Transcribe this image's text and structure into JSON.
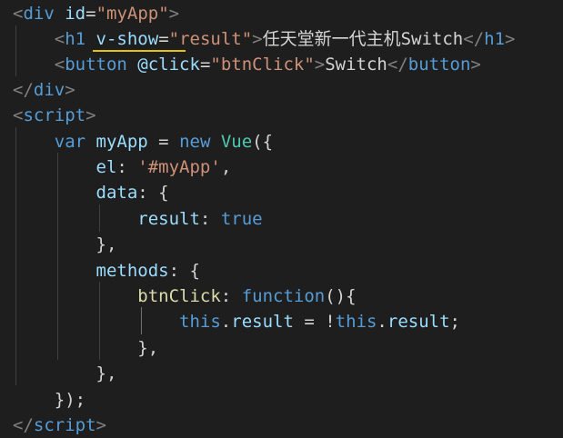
{
  "code": {
    "line1": {
      "open": "<",
      "tag": "div",
      "attr": " id",
      "eq": "=",
      "val": "\"myApp\"",
      "close": ">"
    },
    "line2": {
      "open": "<",
      "tag": "h1",
      "attr": " v-show",
      "eq": "=",
      "val": "\"result\"",
      "close": ">",
      "text": "任天堂新一代主机Switch",
      "end_open": "</",
      "end_tag": "h1",
      "end_close": ">"
    },
    "line3": {
      "open": "<",
      "tag": "button",
      "attr": " @click",
      "eq": "=",
      "val": "\"btnClick\"",
      "close": ">",
      "text": "Switch",
      "end_open": "</",
      "end_tag": "button",
      "end_close": ">"
    },
    "line4": {
      "open": "</",
      "tag": "div",
      "close": ">"
    },
    "line5": {
      "open": "<",
      "tag": "script",
      "close": ">"
    },
    "line6": {
      "kw": "var",
      "var": " myApp",
      "op": " = ",
      "kw2": "new",
      "cls": " Vue",
      "rest": "({"
    },
    "line7": {
      "prop": "el",
      "colon": ": ",
      "str": "'#myApp'",
      "rest": ","
    },
    "line8": {
      "prop": "data",
      "rest": ": {"
    },
    "line9": {
      "prop": "result",
      "colon": ": ",
      "kw": "true"
    },
    "line10": {
      "rest": "},"
    },
    "line11": {
      "prop": "methods",
      "rest": ": {"
    },
    "line12": {
      "fn": "btnClick",
      "colon": ": ",
      "kw": "function",
      "rest": "(){"
    },
    "line13": {
      "kw": "this",
      "dot": ".",
      "prop": "result",
      "op": " = !",
      "kw2": "this",
      "dot2": ".",
      "prop2": "result",
      "rest": ";"
    },
    "line14": {
      "rest": "},"
    },
    "line15": {
      "rest": "},"
    },
    "line16": {
      "rest": "});"
    },
    "line17": {
      "open": "</",
      "tag": "script",
      "close": ">"
    }
  },
  "colors": {
    "background": "#1e1e1e",
    "tag": "#569cd6",
    "attribute": "#9cdcfe",
    "string": "#ce9178",
    "class": "#4ec9b0",
    "function": "#dcdcaa",
    "underline": "#e2c30c"
  }
}
